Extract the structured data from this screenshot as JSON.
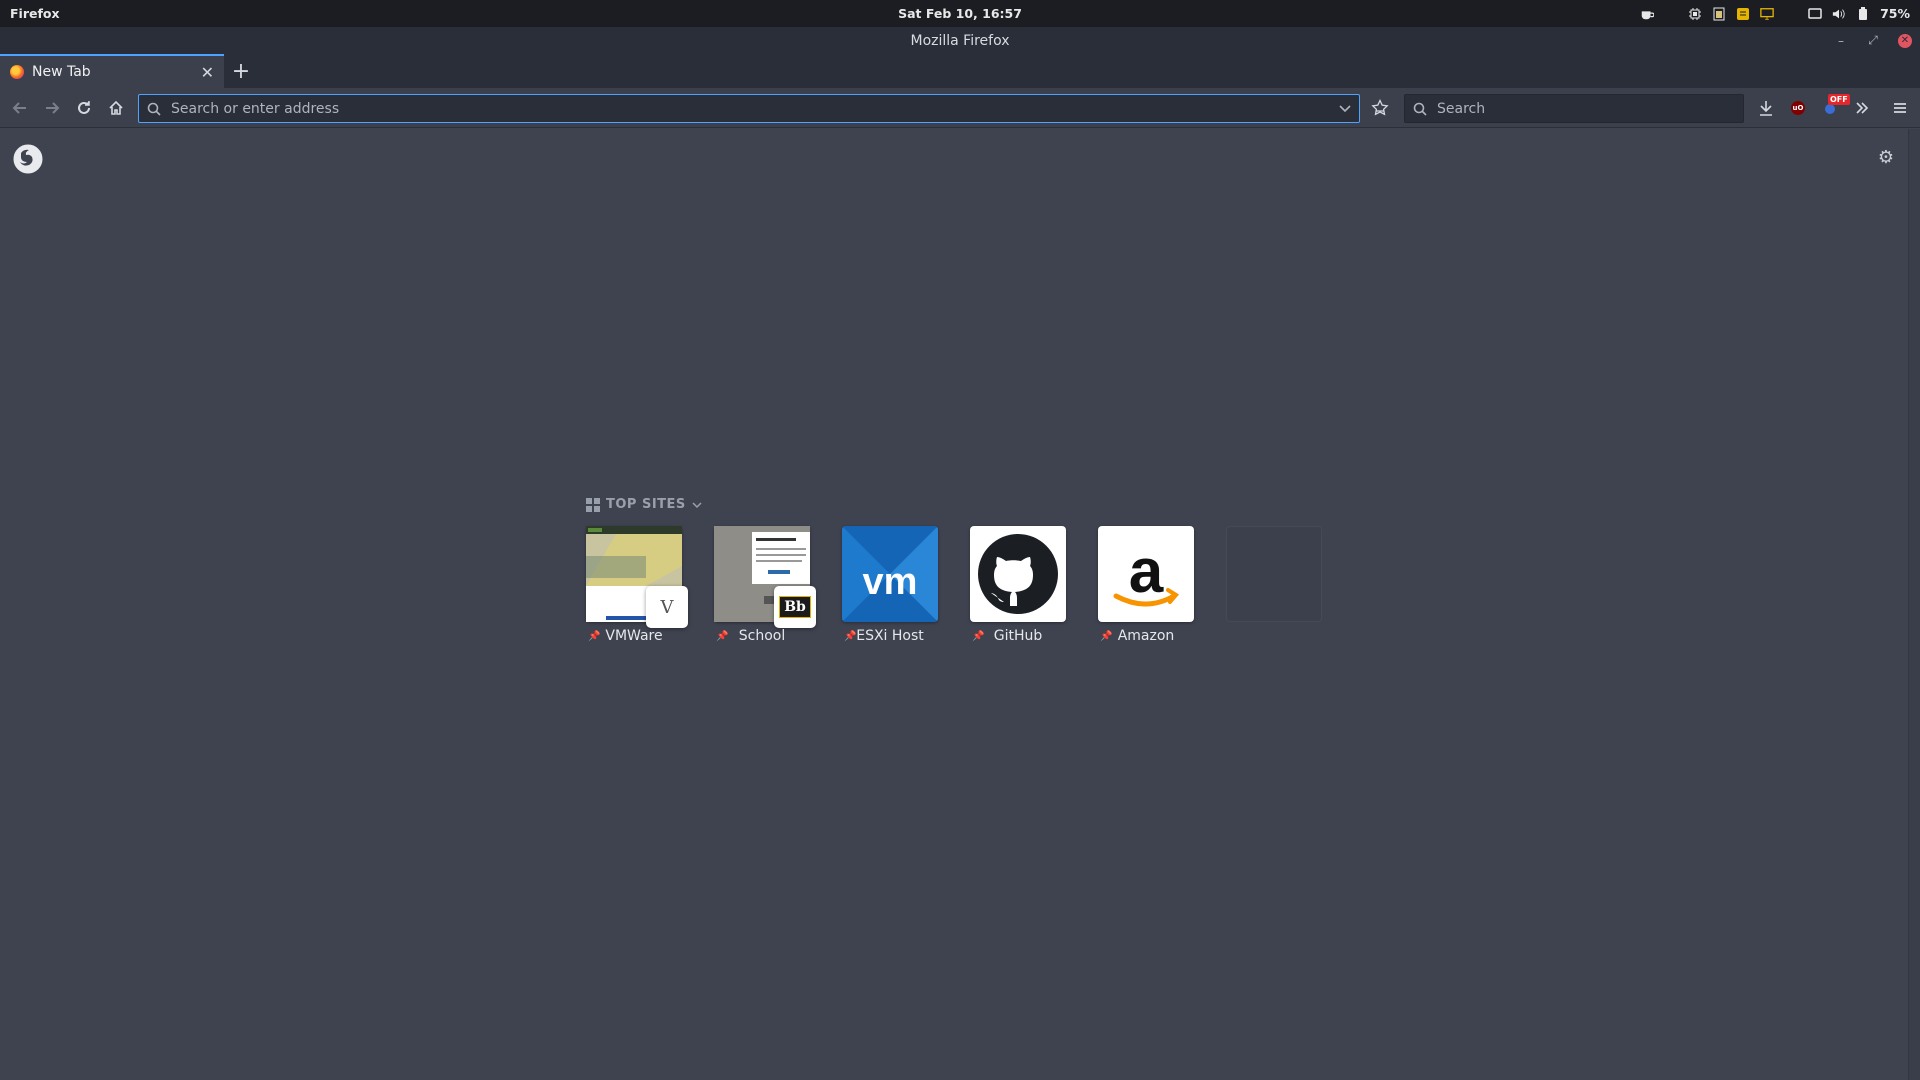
{
  "topbar": {
    "app_name": "Firefox",
    "clock": "Sat Feb 10, 16:57",
    "battery": "75%"
  },
  "window": {
    "title": "Mozilla Firefox"
  },
  "tabs": [
    {
      "label": "New Tab",
      "active": true
    }
  ],
  "navbar": {
    "url_placeholder": "Search or enter address",
    "search_placeholder": "Search",
    "ublock_badge": "OFF"
  },
  "top_sites": {
    "title": "TOP SITES",
    "sites": [
      {
        "label": "VMWare",
        "badge_letter": "V",
        "pinned": true
      },
      {
        "label": "School",
        "badge_letter": "Bb",
        "pinned": true
      },
      {
        "label": "ESXi Host",
        "logo_text": "vm",
        "pinned": true
      },
      {
        "label": "GitHub",
        "pinned": true
      },
      {
        "label": "Amazon",
        "logo_text": "a",
        "pinned": true
      }
    ]
  },
  "colors": {
    "accent": "#4da3ff",
    "background": "#3f4350",
    "toolbar": "#3b404c"
  }
}
